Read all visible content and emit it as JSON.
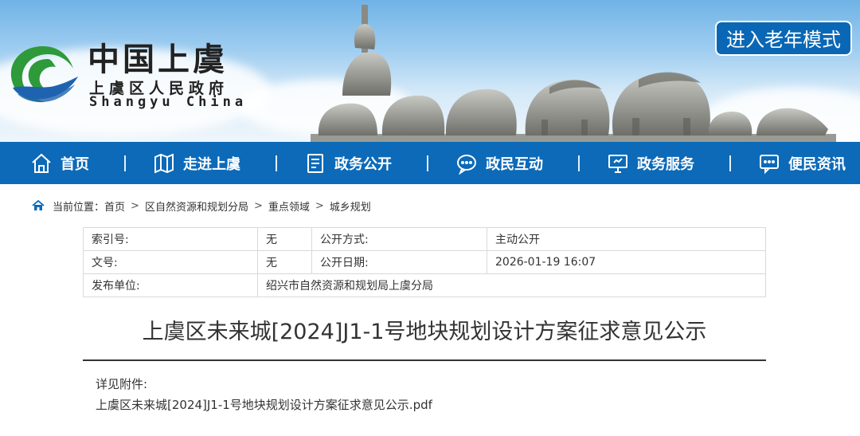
{
  "header": {
    "logo_cn": "中国上虞",
    "logo_district": "上虞区人民政府",
    "logo_en": "Shangyu China",
    "elder_mode_label": "进入老年模式",
    "colors": {
      "nav": "#0c6ab8",
      "accent": "#0a67b5",
      "logo_green": "#2e9a3a"
    }
  },
  "nav": {
    "items": [
      {
        "label": "首页",
        "icon": "home-icon"
      },
      {
        "label": "走进上虞",
        "icon": "map-icon"
      },
      {
        "label": "政务公开",
        "icon": "document-icon"
      },
      {
        "label": "政民互动",
        "icon": "chat-icon"
      },
      {
        "label": "政务服务",
        "icon": "monitor-icon"
      },
      {
        "label": "便民资讯",
        "icon": "message-icon"
      }
    ]
  },
  "breadcrumb": {
    "prefix": "当前位置：",
    "items": [
      "首页",
      "区自然资源和规划分局",
      "重点领域",
      "城乡规划"
    ],
    "separator": ">"
  },
  "info_table": {
    "index_label": "索引号:",
    "index_value": "无",
    "open_method_label": "公开方式:",
    "open_method_value": "主动公开",
    "doc_no_label": "文号:",
    "doc_no_value": "无",
    "open_date_label": "公开日期:",
    "open_date_value": "2026-01-19 16:07",
    "publisher_label": "发布单位:",
    "publisher_value": "绍兴市自然资源和规划局上虞分局"
  },
  "article": {
    "title": "上虞区未来城[2024]J1-1号地块规划设计方案征求意见公示",
    "attachment_label": "详见附件:",
    "attachment_file": "上虞区未来城[2024]J1-1号地块规划设计方案征求意见公示.pdf"
  }
}
